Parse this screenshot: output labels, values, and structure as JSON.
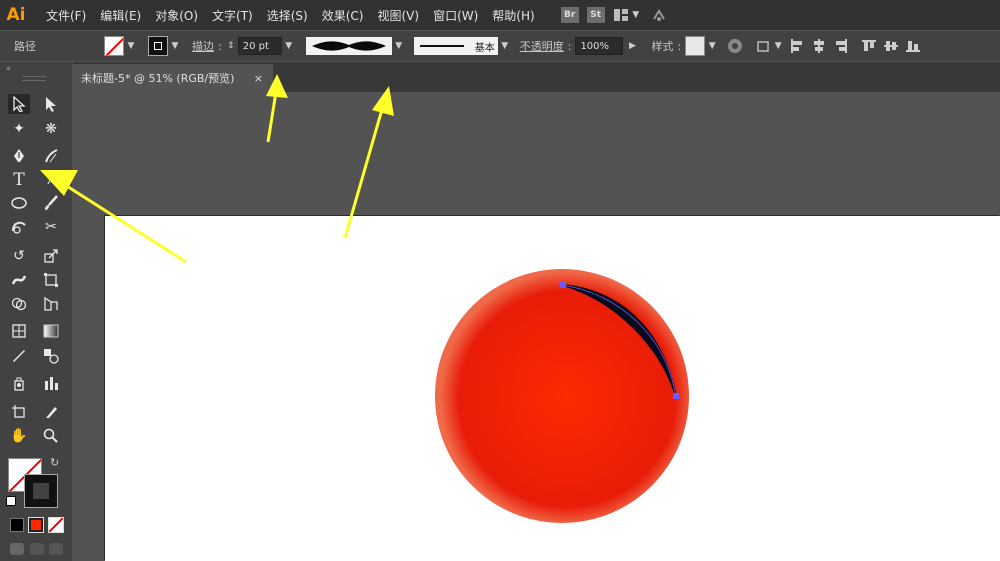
{
  "app": {
    "logo": "Ai",
    "accent": "#ff9a00"
  },
  "menu": [
    "文件(F)",
    "编辑(E)",
    "对象(O)",
    "文字(T)",
    "选择(S)",
    "效果(C)",
    "视图(V)",
    "窗口(W)",
    "帮助(H)"
  ],
  "menubar_extras": {
    "bridge": "Br",
    "stock": "St",
    "layout_icon": "layout-grid-icon",
    "sync_icon": "sync-icon"
  },
  "control": {
    "selection_type": "路径",
    "stroke_label": "描边",
    "stroke_weight": "20 pt",
    "stroke_profile": "基本",
    "opacity_label": "不透明度",
    "opacity_value": "100%",
    "style_label": "样式"
  },
  "document": {
    "tab_title": "未标题-5* @ 51% (RGB/预览)",
    "close_glyph": "×"
  },
  "tools": [
    "selection-tool",
    "direct-selection-tool",
    "magic-wand-tool",
    "lasso-tool",
    "pen-tool",
    "curvature-tool",
    "type-tool",
    "line-segment-tool",
    "ellipse-tool",
    "paintbrush-tool",
    "shaper-tool",
    "scissors-tool",
    "rotate-tool",
    "scale-tool",
    "width-tool",
    "free-transform-tool",
    "shape-builder-tool",
    "perspective-grid-tool",
    "mesh-tool",
    "gradient-tool",
    "eyedropper-tool",
    "blend-tool",
    "symbol-sprayer-tool",
    "column-graph-tool",
    "artboard-tool",
    "slice-tool",
    "hand-tool",
    "zoom-tool"
  ],
  "colors": {
    "circle_center": "#ff2a00",
    "circle_mid": "#e81c08",
    "circle_edge": "#f06a4a",
    "path_stroke": "#0a0a1e",
    "anchor": "#6a5cff",
    "arrow": "#ffff2a"
  }
}
